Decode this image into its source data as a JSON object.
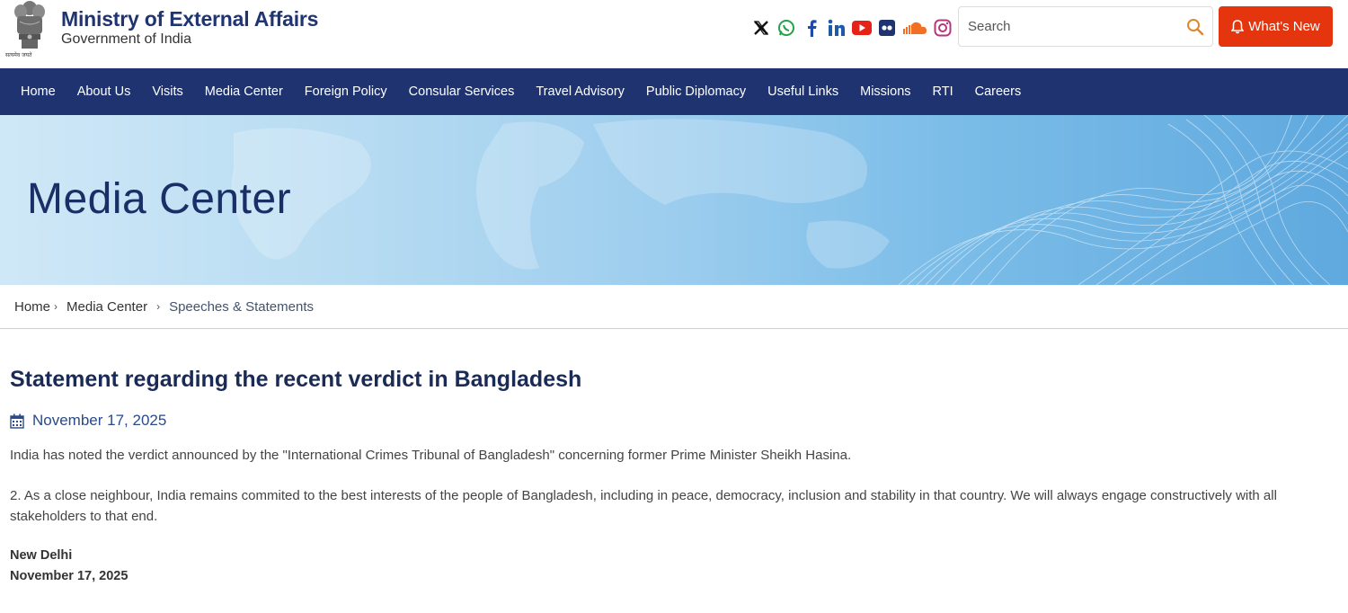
{
  "header": {
    "org_title": "Ministry of External Affairs",
    "org_subtitle": "Government of India",
    "emblem_caption": "सत्यमेव जयते",
    "social_icons": [
      "x-icon",
      "whatsapp-icon",
      "facebook-icon",
      "linkedin-icon",
      "youtube-icon",
      "flickr-icon",
      "soundcloud-icon",
      "instagram-icon"
    ],
    "search": {
      "placeholder": "Search"
    },
    "whats_new_label": "What's New"
  },
  "nav": {
    "items": [
      "Home",
      "About Us",
      "Visits",
      "Media Center",
      "Foreign Policy",
      "Consular Services",
      "Travel Advisory",
      "Public Diplomacy",
      "Useful Links",
      "Missions",
      "RTI",
      "Careers"
    ]
  },
  "banner": {
    "title": "Media Center"
  },
  "breadcrumb": {
    "home": "Home",
    "section": "Media Center",
    "current": "Speeches & Statements"
  },
  "article": {
    "title": "Statement regarding the recent verdict in Bangladesh",
    "date": "November 17, 2025",
    "paragraphs": [
      "India has noted the verdict announced by the \"International Crimes Tribunal of Bangladesh\" concerning former Prime Minister Sheikh Hasina.",
      "2. As a close neighbour, India remains commited to the best interests of the people of Bangladesh, including in peace, democracy, inclusion and stability in that country. We will always engage constructively with all stakeholders to that end."
    ],
    "place": "New Delhi",
    "sign_date": "November 17, 2025"
  },
  "colors": {
    "navy": "#1e3370",
    "whats_new_bg": "#e5350e",
    "title_text": "#1a2b55",
    "date_text": "#2a4a8a"
  }
}
